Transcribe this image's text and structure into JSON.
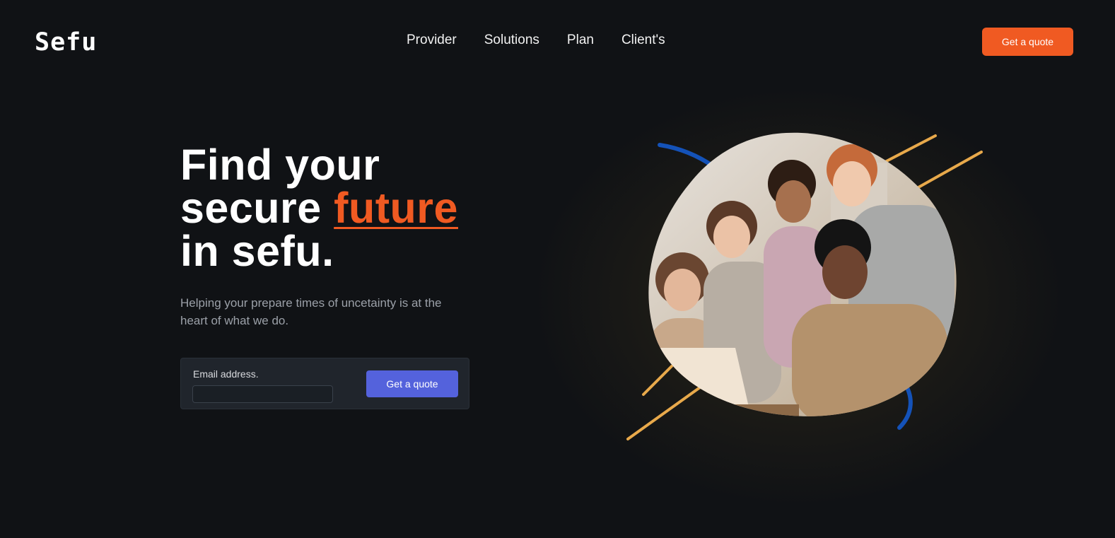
{
  "brand": {
    "logo": "Sefu"
  },
  "nav": {
    "items": [
      "Provider",
      "Solutions",
      "Plan",
      "Client's"
    ]
  },
  "header": {
    "cta_label": "Get a quote"
  },
  "hero": {
    "headline_line1": "Find your",
    "headline_line2_prefix": "secure ",
    "headline_accent": "future",
    "headline_line3": "in sefu.",
    "subtext": "Helping your prepare times of uncetainty is at the heart of what we do.",
    "form": {
      "label": "Email address.",
      "value": "",
      "button_label": "Get a quote"
    },
    "image_name": "team-photo"
  },
  "colors": {
    "background": "#101215",
    "accent": "#f05a22",
    "form_button": "#5462dc",
    "decor_blue": "#1452b8",
    "decor_gold": "#e8a94b"
  }
}
